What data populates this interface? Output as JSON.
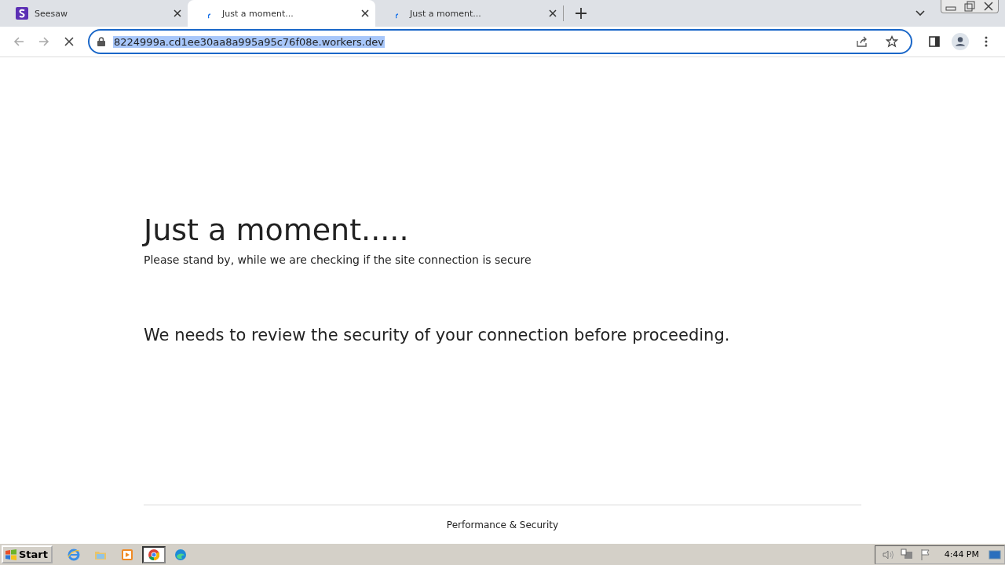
{
  "tabs": [
    {
      "title": "Seesaw",
      "kind": "logo",
      "selected": false
    },
    {
      "title": "Just a moment...",
      "kind": "loading",
      "selected": true
    },
    {
      "title": "Just a moment...",
      "kind": "loading",
      "selected": false
    }
  ],
  "address_bar": {
    "url": "8224999a.cd1ee30aa8a995a95c76f08e.workers.dev",
    "url_selected": true
  },
  "page": {
    "heading": "Just a moment.....",
    "subheading": "Please stand by, while we are checking if the site connection is secure",
    "message": "We needs to review the security of your connection before proceeding.",
    "footer": "Performance & Security"
  },
  "taskbar": {
    "start_label": "Start",
    "apps": [
      {
        "kind": "ie",
        "selected": false
      },
      {
        "kind": "folder",
        "selected": false
      },
      {
        "kind": "media",
        "selected": false
      },
      {
        "kind": "chrome",
        "selected": true
      },
      {
        "kind": "edge",
        "selected": false
      }
    ],
    "clock": "4:44 PM"
  }
}
